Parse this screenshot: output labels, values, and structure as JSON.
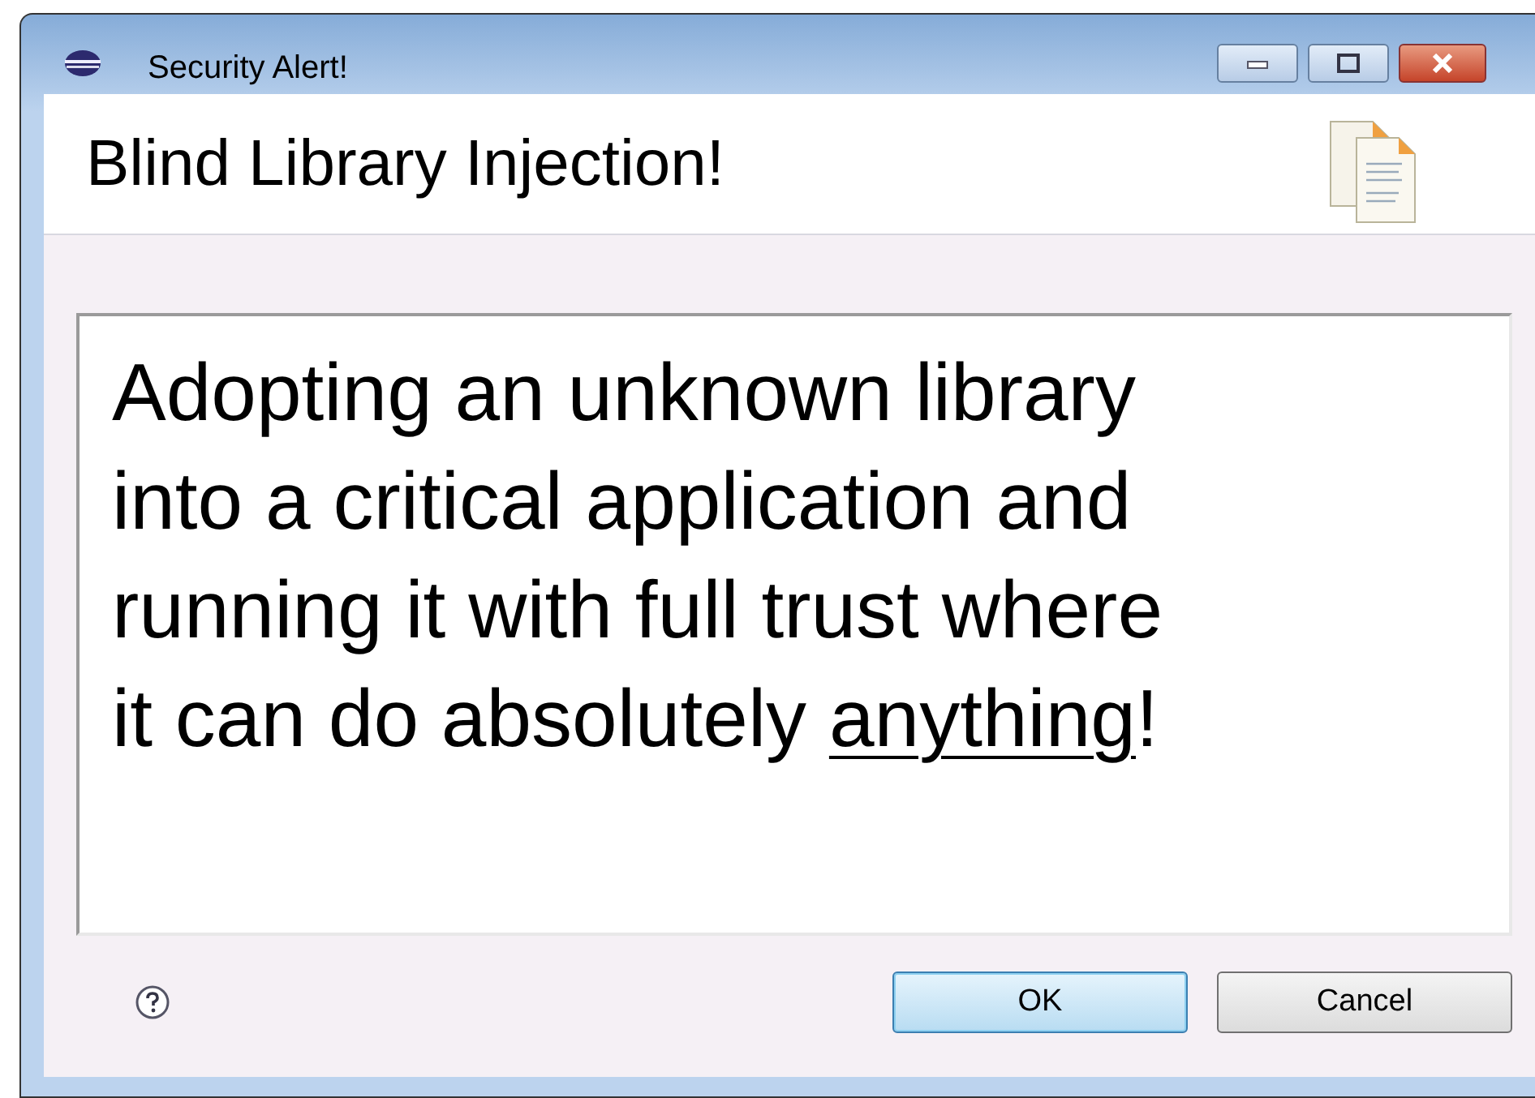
{
  "window": {
    "title": "Security Alert!"
  },
  "header": {
    "title": "Blind Library Injection!"
  },
  "message_lines": [
    [
      {
        "text": "Adopting an unknown library",
        "underline": false
      }
    ],
    [
      {
        "text": "into a critical application and",
        "underline": false
      }
    ],
    [
      {
        "text": "running it with full trust where",
        "underline": false
      }
    ],
    [
      {
        "text": "it can do absolutely ",
        "underline": false
      },
      {
        "text": "anything",
        "underline": true
      },
      {
        "text": "!",
        "underline": false
      }
    ]
  ],
  "buttons": [
    {
      "label": "OK",
      "default": true
    },
    {
      "label": "Cancel",
      "default": false
    }
  ]
}
